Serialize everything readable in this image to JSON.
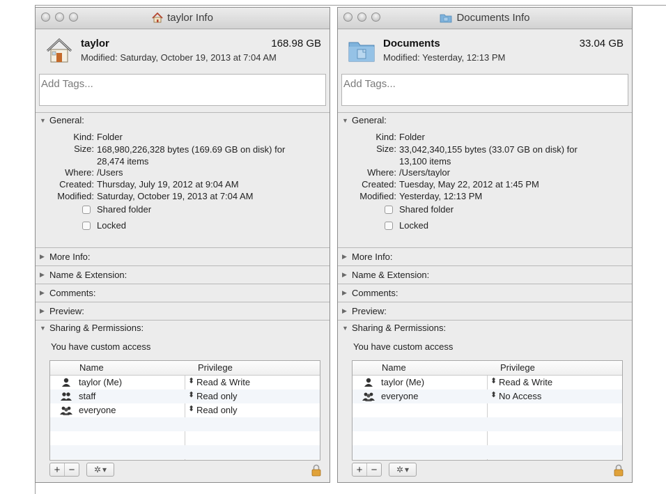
{
  "windows": [
    {
      "title": "taylor Info",
      "name": "taylor",
      "size": "168.98 GB",
      "modified_header": "Modified: Saturday, October 19, 2013 at 7:04 AM",
      "tags_placeholder": "Add Tags...",
      "general_label": "General:",
      "general": {
        "kind_key": "Kind:",
        "kind": "Folder",
        "size_key": "Size:",
        "size_line1": "168,980,226,328 bytes (169.69 GB on disk) for",
        "size_line2": "28,474 items",
        "where_key": "Where:",
        "where": "/Users",
        "created_key": "Created:",
        "created": "Thursday, July 19, 2012 at 9:04 AM",
        "modified_key": "Modified:",
        "modified": "Saturday, October 19, 2013 at 7:04 AM",
        "shared_folder": "Shared folder",
        "locked": "Locked"
      },
      "sections": [
        "More Info:",
        "Name & Extension:",
        "Comments:",
        "Preview:"
      ],
      "sharing_label": "Sharing & Permissions:",
      "access_text": "You have custom access",
      "table_headers": {
        "name": "Name",
        "privilege": "Privilege"
      },
      "permissions": [
        {
          "name": "taylor (Me)",
          "privilege": "Read & Write",
          "icon": "single-user-icon"
        },
        {
          "name": "staff",
          "privilege": "Read only",
          "icon": "group-icon"
        },
        {
          "name": "everyone",
          "privilege": "Read only",
          "icon": "everyone-icon"
        }
      ]
    },
    {
      "title": "Documents Info",
      "name": "Documents",
      "size": "33.04 GB",
      "modified_header": "Modified: Yesterday, 12:13 PM",
      "tags_placeholder": "Add Tags...",
      "general_label": "General:",
      "general": {
        "kind_key": "Kind:",
        "kind": "Folder",
        "size_key": "Size:",
        "size_line1": "33,042,340,155 bytes (33.07 GB on disk) for",
        "size_line2": "13,100 items",
        "where_key": "Where:",
        "where": "/Users/taylor",
        "created_key": "Created:",
        "created": "Tuesday, May 22, 2012 at 1:45 PM",
        "modified_key": "Modified:",
        "modified": "Yesterday, 12:13 PM",
        "shared_folder": "Shared folder",
        "locked": "Locked"
      },
      "sections": [
        "More Info:",
        "Name & Extension:",
        "Comments:",
        "Preview:"
      ],
      "sharing_label": "Sharing & Permissions:",
      "access_text": "You have custom access",
      "table_headers": {
        "name": "Name",
        "privilege": "Privilege"
      },
      "permissions": [
        {
          "name": "taylor (Me)",
          "privilege": "Read & Write",
          "icon": "single-user-icon"
        },
        {
          "name": "everyone",
          "privilege": "No Access",
          "icon": "everyone-icon"
        }
      ]
    }
  ],
  "toolbar": {
    "add": "+",
    "remove": "−",
    "gear_arrow": "▾"
  },
  "colors": {
    "window_bg": "#ececec",
    "folder_blue": "#7fb3dc",
    "house_red": "#b5452f",
    "lock_gold": "#e0a23a"
  }
}
